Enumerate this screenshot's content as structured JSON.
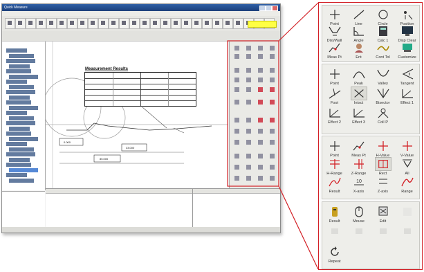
{
  "app": {
    "title": "Quick Measure",
    "measurement_results": {
      "title": "Measurement Results"
    },
    "canvas_dimensions": [
      "0.000",
      "33.000",
      "85.000"
    ]
  },
  "callout": {
    "sections": [
      {
        "buttons": [
          {
            "label": "Point",
            "icon": "point-icon"
          },
          {
            "label": "Line",
            "icon": "line-icon"
          },
          {
            "label": "Circle",
            "icon": "circle-icon"
          },
          {
            "label": "Position",
            "icon": "position-icon"
          },
          {
            "label": "Dist/Wall",
            "icon": "distance-wall-icon"
          },
          {
            "label": "Angle",
            "icon": "angle-icon"
          },
          {
            "label": "Calc 1",
            "icon": "calculator-icon"
          },
          {
            "label": "Disp Clear",
            "icon": "display-clear-icon"
          },
          {
            "label": "Meas Pt",
            "icon": "measure-point-icon"
          },
          {
            "label": "Ent",
            "icon": "enter-icon"
          },
          {
            "label": "Cont Tol",
            "icon": "contour-tolerance-icon"
          },
          {
            "label": "Customize",
            "icon": "customize-icon"
          }
        ]
      },
      {
        "buttons": [
          {
            "label": "Point",
            "icon": "crosshair-icon"
          },
          {
            "label": "Peak",
            "icon": "peak-icon"
          },
          {
            "label": "Valley",
            "icon": "valley-icon"
          },
          {
            "label": "Tangent",
            "icon": "tangent-icon"
          },
          {
            "label": "Foot",
            "icon": "foot-icon"
          },
          {
            "label": "Intsct",
            "icon": "intersect-icon"
          },
          {
            "label": "Bisector",
            "icon": "bisector-icon"
          },
          {
            "label": "Effect 1",
            "icon": "effect-icon"
          },
          {
            "label": "Effect 2",
            "icon": "effect-icon"
          },
          {
            "label": "Effect 3",
            "icon": "effect-icon"
          },
          {
            "label": "Coll P",
            "icon": "collect-point-icon"
          }
        ]
      },
      {
        "buttons": [
          {
            "label": "Point",
            "icon": "crosshair-icon"
          },
          {
            "label": "Meas Pt",
            "icon": "measure-point-icon"
          },
          {
            "label": "H-Value",
            "icon": "h-value-icon"
          },
          {
            "label": "V-Value",
            "icon": "v-value-icon"
          },
          {
            "label": "H-Range",
            "icon": "h-range-icon"
          },
          {
            "label": "Z-Range",
            "icon": "z-range-icon"
          },
          {
            "label": "Rect",
            "icon": "rectangle-icon"
          },
          {
            "label": "All",
            "icon": "all-icon"
          },
          {
            "label": "Result",
            "icon": "result-icon"
          },
          {
            "label": "X-axis",
            "icon": "x-axis-icon"
          },
          {
            "label": "Z-axis",
            "icon": "z-axis-icon"
          },
          {
            "label": "Range",
            "icon": "range-icon"
          }
        ]
      },
      {
        "buttons": [
          {
            "label": "Result",
            "icon": "result-bar-icon"
          },
          {
            "label": "Mouse",
            "icon": "mouse-icon"
          },
          {
            "label": "Edit",
            "icon": "edit-icon"
          },
          {
            "label": "",
            "icon": "blank-icon"
          },
          {
            "label": "",
            "icon": "disabled-icon"
          },
          {
            "label": "",
            "icon": "disabled-icon"
          },
          {
            "label": "",
            "icon": "disabled-icon"
          },
          {
            "label": "",
            "icon": "disabled-icon"
          },
          {
            "label": "Repeat",
            "icon": "repeat-icon"
          }
        ]
      }
    ]
  },
  "colors": {
    "callout_border": "#d32026",
    "icon_red": "#d32026",
    "highlight": "#ffff44",
    "title_bar": "#2f5fa6"
  }
}
